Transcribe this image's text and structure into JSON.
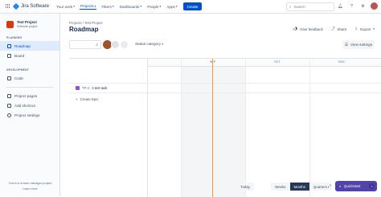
{
  "topbar": {
    "app_name": "Jira Software",
    "nav": [
      {
        "label": "Your work"
      },
      {
        "label": "Projects"
      },
      {
        "label": "Filters"
      },
      {
        "label": "Dashboards"
      },
      {
        "label": "People"
      },
      {
        "label": "Apps"
      }
    ],
    "create_label": "Create",
    "search_placeholder": "Search"
  },
  "sidebar": {
    "project_name": "Test Project",
    "project_type": "Software project",
    "planning_heading": "PLANNING",
    "planning_items": [
      {
        "label": "Roadmap",
        "selected": true
      },
      {
        "label": "Board",
        "selected": false
      }
    ],
    "development_heading": "DEVELOPMENT",
    "development_items": [
      {
        "label": "Code"
      }
    ],
    "other_items": [
      {
        "label": "Project pages"
      },
      {
        "label": "Add shortcut"
      },
      {
        "label": "Project settings"
      }
    ],
    "footer_text": "You're in a team-managed project",
    "footer_link": "Learn more"
  },
  "main": {
    "breadcrumb": [
      "Projects",
      "Test Project"
    ],
    "title": "Roadmap",
    "actions": {
      "feedback": "Give feedback",
      "share": "Share",
      "export": "Export"
    },
    "status_category": "Status category",
    "view_settings": "View settings",
    "months": [
      "SEP",
      "OCT",
      "NOV"
    ],
    "task": {
      "key": "TP-2",
      "summary": "A test task"
    },
    "create_epic": "Create Epic",
    "today_button": "Today",
    "zoom": [
      {
        "label": "Weeks",
        "active": false
      },
      {
        "label": "Months",
        "active": true
      },
      {
        "label": "Quarters",
        "active": false
      }
    ],
    "quickstart": "Quickstart"
  },
  "colors": {
    "brand": "#0052cc",
    "today_line": "#ff991f",
    "quickstart": "#5243aa",
    "epic": "#904ee2"
  }
}
